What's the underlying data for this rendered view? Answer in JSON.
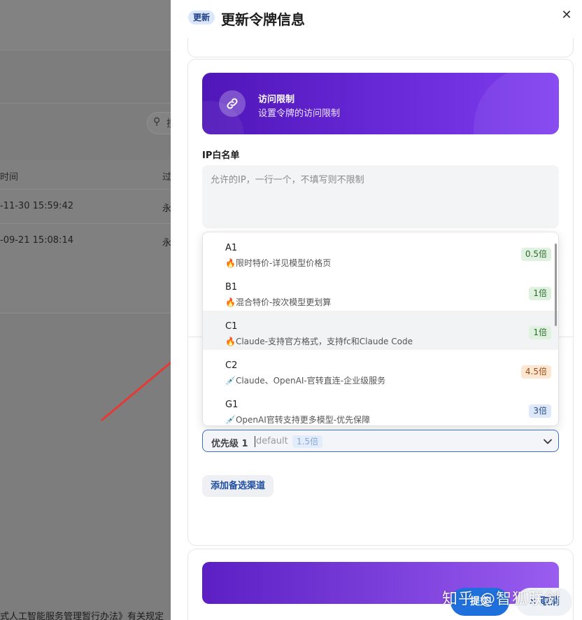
{
  "background": {
    "search_text": "搜",
    "table_headers": [
      "时间",
      "过"
    ],
    "rows": [
      {
        "time": "-11-30 15:59:42",
        "expire": "永"
      },
      {
        "time": "-09-21 15:08:14",
        "expire": "永"
      }
    ],
    "footer_text": "式人工智能服务管理暂行办法》有关规定"
  },
  "drawer": {
    "tag": "更新",
    "title": "更新令牌信息",
    "close_symbol": "✕"
  },
  "access": {
    "banner_title": "访问限制",
    "banner_subtitle": "设置令牌的访问限制",
    "ip_label": "IP白名单",
    "ip_placeholder": "允许的IP，一行一个，不填写则不限制",
    "ip_value": ""
  },
  "dropdown": {
    "options": [
      {
        "name": "A1",
        "desc": "🔥限时特价-详见模型价格页",
        "badge": "0.5倍",
        "color": "green",
        "selected": false
      },
      {
        "name": "B1",
        "desc": "🔥混合特价-按次模型更划算",
        "badge": "1倍",
        "color": "green",
        "selected": false
      },
      {
        "name": "C1",
        "desc": "🔥Claude-支持官方格式，支持fc和Claude Code",
        "badge": "1倍",
        "color": "green",
        "selected": true
      },
      {
        "name": "C2",
        "desc": "💉Claude、OpenAI-官转直连-企业级服务",
        "badge": "4.5倍",
        "color": "orange",
        "selected": false
      },
      {
        "name": "G1",
        "desc": "💉OpenAI官转支持更多模型-优先保障",
        "badge": "3倍",
        "color": "blue",
        "selected": false
      }
    ]
  },
  "select": {
    "prefix": "优先级 1",
    "value": "default",
    "badge": "1.5倍"
  },
  "add_button": "添加备选渠道",
  "footer": {
    "submit": "提交",
    "cancel": "✕ 取消"
  },
  "watermark": "知乎 @智狐联剑",
  "colors": {
    "accent": "#1f6fdc",
    "banner_start": "#4f16b8",
    "banner_end": "#7f3ff0",
    "annotation_arrow": "#e53935"
  }
}
